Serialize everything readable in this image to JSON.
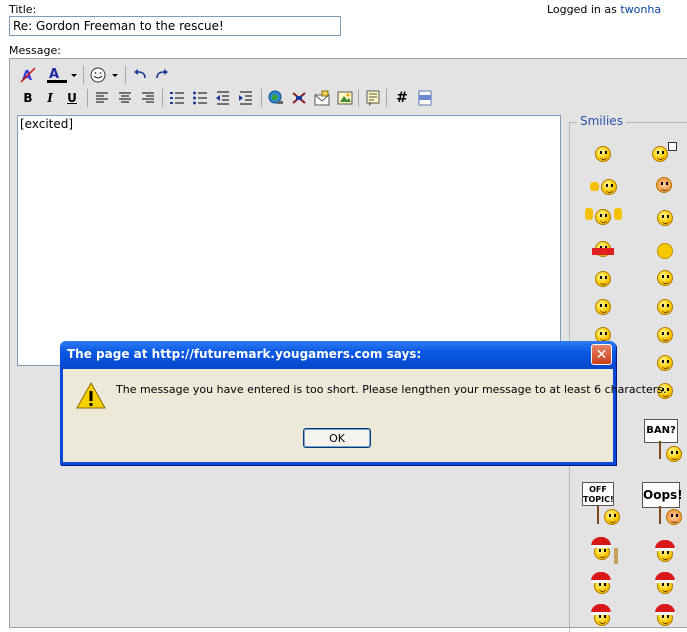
{
  "header": {
    "title_label": "Title:",
    "title_value": "Re: Gordon Freeman to the rescue!",
    "logged_in_prefix": "Logged in as",
    "username": "twonha",
    "message_label": "Message:"
  },
  "toolbar": {
    "bold": "B",
    "italic": "I",
    "underline": "U",
    "hash": "#",
    "font_color_letter": "A"
  },
  "editor": {
    "content": "[excited]"
  },
  "smilies": {
    "legend": "Smilies",
    "signs": [
      "BAN?",
      "OFF TOPIC!",
      "Oops!"
    ]
  },
  "dialog": {
    "title": "The page at http://futuremark.yougamers.com says:",
    "message": "The message you have entered is too short. Please lengthen your message to at least 6 characters.",
    "ok_label": "OK",
    "close_glyph": "✕"
  },
  "colors": {
    "link": "#0b45a4",
    "dialog_title_bg": "#0a58e4",
    "dialog_body_bg": "#ece9d8",
    "panel_bg": "#e3e3e3"
  }
}
